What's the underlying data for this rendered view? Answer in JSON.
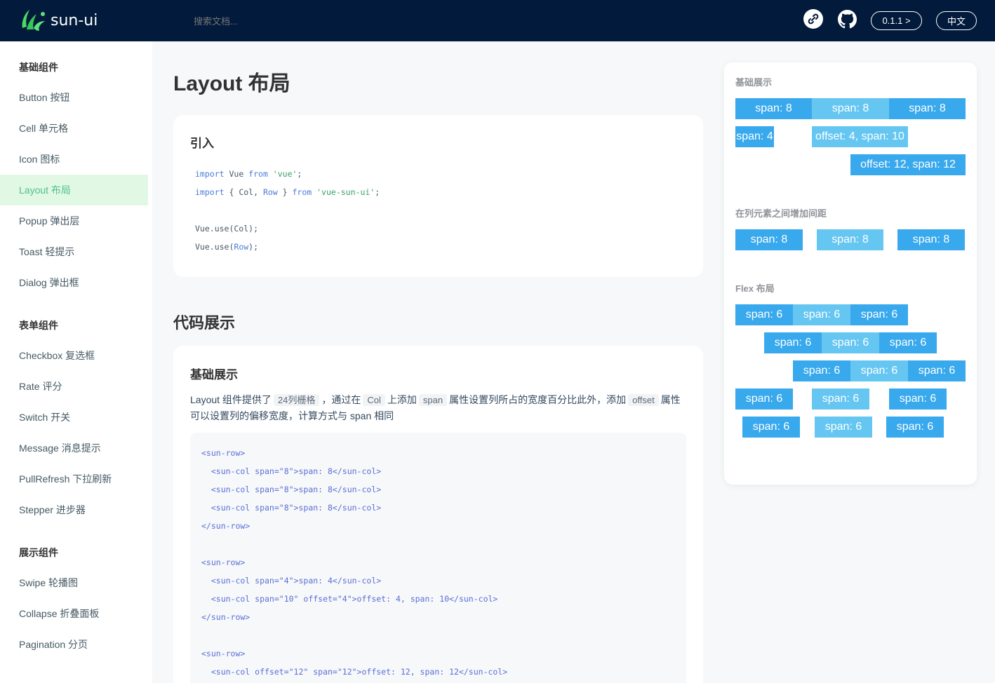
{
  "header": {
    "logo_text": "sun-ui",
    "search_placeholder": "搜索文档...",
    "version": "0.1.1 >",
    "language": "中文",
    "icons": [
      "link-icon",
      "github-icon"
    ]
  },
  "sidebar": {
    "groups": [
      {
        "title": "基础组件",
        "items": [
          "Button 按钮",
          "Cell 单元格",
          "Icon 图标",
          "Layout 布局",
          "Popup 弹出层",
          "Toast 轻提示",
          "Dialog 弹出框"
        ]
      },
      {
        "title": "表单组件",
        "items": [
          "Checkbox 复选框",
          "Rate 评分",
          "Switch 开关",
          "Message 消息提示",
          "PullRefresh 下拉刷新",
          "Stepper 进步器"
        ]
      },
      {
        "title": "展示组件",
        "items": [
          "Swipe 轮播图",
          "Collapse 折叠面板",
          "Pagination 分页"
        ]
      }
    ],
    "active": "Layout 布局"
  },
  "main": {
    "page_title": "Layout 布局",
    "intro_card": {
      "title": "引入",
      "code": {
        "l1": {
          "a": "import",
          "b": " Vue ",
          "c": "from",
          "d": " 'vue'",
          "e": ";"
        },
        "l2": {
          "a": "import",
          "b": " { Col, ",
          "c": "Row",
          "d": " } ",
          "e": "from",
          "f": " 'vue-sun-ui'",
          "g": ";"
        },
        "l3": {
          "a": "Vue.use(Col);"
        },
        "l4": {
          "a": "Vue.use(",
          "b": "Row",
          "c": ");"
        }
      }
    },
    "section_title": "代码展示",
    "demo_card": {
      "title": "基础展示",
      "desc": {
        "p1": "Layout 组件提供了",
        "c1": "24列栅格",
        "p2": "，通过在",
        "c2": "Col",
        "p3": "上添加",
        "c3": "span",
        "p4": "属性设置列所占的宽度百分比此外，添加",
        "c4": "offset",
        "p5": "属性可以设置列的偏移宽度，计算方式与 span 相同"
      },
      "code_lines": [
        "<sun-row>",
        "  <sun-col span=\"8\">span: 8</sun-col>",
        "  <sun-col span=\"8\">span: 8</sun-col>",
        "  <sun-col span=\"8\">span: 8</sun-col>",
        "</sun-row>",
        "",
        "<sun-row>",
        "  <sun-col span=\"4\">span: 4</sun-col>",
        "  <sun-col span=\"10\" offset=\"4\">offset: 4, span: 10</sun-col>",
        "</sun-row>",
        "",
        "<sun-row>",
        "  <sun-col offset=\"12\" span=\"12\">offset: 12, span: 12</sun-col>"
      ]
    }
  },
  "preview": {
    "sections": [
      {
        "title": "基础展示"
      },
      {
        "title": "在列元素之间增加间距"
      },
      {
        "title": "Flex 布局"
      }
    ],
    "basic_rows": [
      [
        "span: 8",
        "span: 8",
        "span: 8"
      ],
      [
        "span: 4",
        "offset: 4, span: 10"
      ],
      [
        "offset: 12, span: 12"
      ]
    ],
    "gutter_row": [
      "span: 8",
      "span: 8",
      "span: 8"
    ],
    "flex_rows": [
      [
        "span: 6",
        "span: 6",
        "span: 6"
      ],
      [
        "span: 6",
        "span: 6",
        "span: 6"
      ],
      [
        "span: 6",
        "span: 6",
        "span: 6"
      ],
      [
        "span: 6",
        "span: 6",
        "span: 6"
      ],
      [
        "span: 6",
        "span: 6",
        "span: 6"
      ]
    ],
    "colors": {
      "dark": "#39a9ed",
      "light": "#66c6f2"
    }
  }
}
